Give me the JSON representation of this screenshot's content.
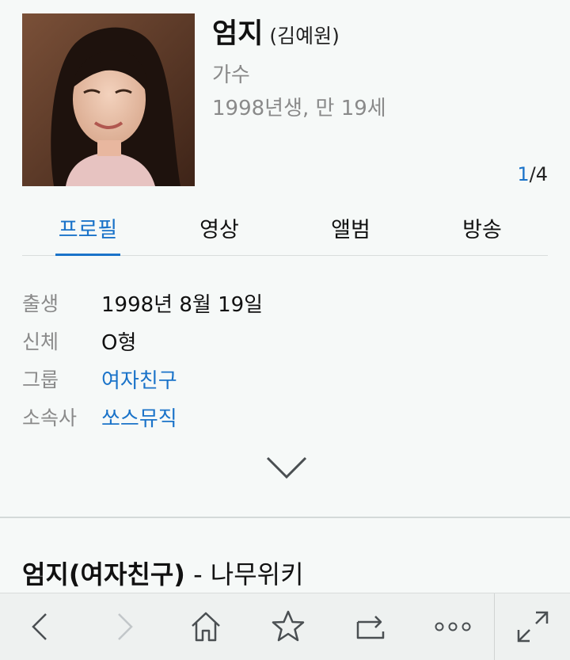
{
  "profile": {
    "name": "엄지",
    "real_name": "(김예원)",
    "job": "가수",
    "birth_summary": "1998년생, 만 19세",
    "image_counter": {
      "current": "1",
      "total": "/4"
    }
  },
  "tabs": [
    {
      "label": "프로필",
      "active": true
    },
    {
      "label": "영상",
      "active": false
    },
    {
      "label": "앨범",
      "active": false
    },
    {
      "label": "방송",
      "active": false
    }
  ],
  "info": [
    {
      "label": "출생",
      "value": "1998년 8월 19일",
      "link": false
    },
    {
      "label": "신체",
      "value": "O형",
      "link": false
    },
    {
      "label": "그룹",
      "value": "여자친구",
      "link": true
    },
    {
      "label": "소속사",
      "value": "쏘스뮤직",
      "link": true
    }
  ],
  "search_result": {
    "title_bold": "엄지(여자친구)",
    "title_rest": " - 나무위키"
  },
  "bottom_bar": {
    "icons": [
      "back-icon",
      "forward-icon",
      "home-icon",
      "bookmark-star-icon",
      "tabs-switch-icon",
      "more-icon",
      "fullscreen-icon"
    ]
  },
  "colors": {
    "accent": "#1a73c9",
    "muted_text": "#8a8a8a",
    "background": "#f6f9f8"
  }
}
